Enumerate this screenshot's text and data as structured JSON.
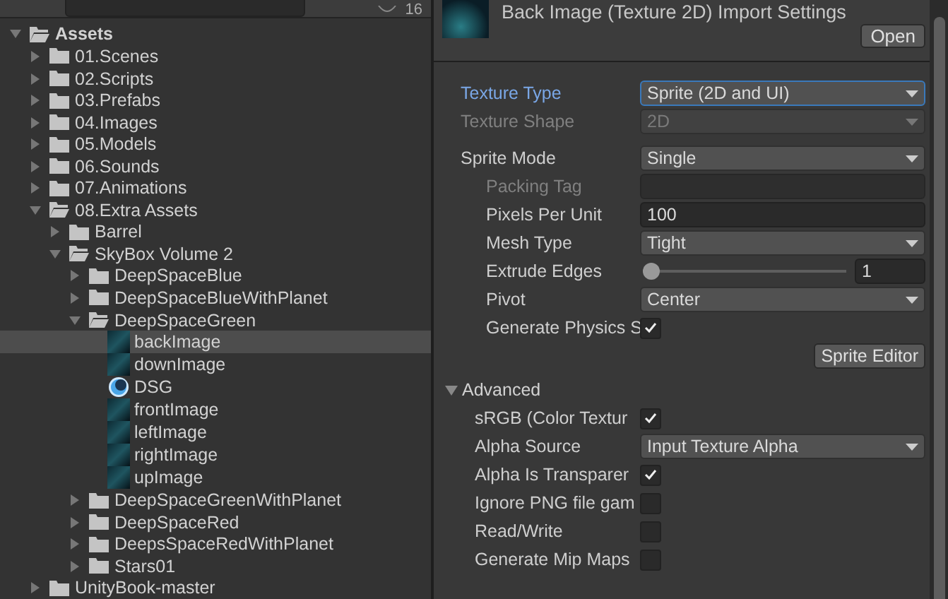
{
  "toolbar": {
    "count": "16"
  },
  "tree": [
    {
      "label": "Assets",
      "kind": "folder",
      "expanded": true,
      "selected": false,
      "children": [
        {
          "label": "01.Scenes",
          "kind": "folder",
          "expanded": false,
          "selected": false
        },
        {
          "label": "02.Scripts",
          "kind": "folder",
          "expanded": false,
          "selected": false
        },
        {
          "label": "03.Prefabs",
          "kind": "folder",
          "expanded": false,
          "selected": false
        },
        {
          "label": "04.Images",
          "kind": "folder",
          "expanded": false,
          "selected": false
        },
        {
          "label": "05.Models",
          "kind": "folder",
          "expanded": false,
          "selected": false
        },
        {
          "label": "06.Sounds",
          "kind": "folder",
          "expanded": false,
          "selected": false
        },
        {
          "label": "07.Animations",
          "kind": "folder",
          "expanded": false,
          "selected": false
        },
        {
          "label": "08.Extra Assets",
          "kind": "folder",
          "expanded": true,
          "selected": false,
          "children": [
            {
              "label": "Barrel",
              "kind": "folder",
              "expanded": false,
              "selected": false
            },
            {
              "label": "SkyBox Volume 2",
              "kind": "folder",
              "expanded": true,
              "selected": false,
              "children": [
                {
                  "label": "DeepSpaceBlue",
                  "kind": "folder",
                  "expanded": false,
                  "selected": false
                },
                {
                  "label": "DeepSpaceBlueWithPlanet",
                  "kind": "folder",
                  "expanded": false,
                  "selected": false
                },
                {
                  "label": "DeepSpaceGreen",
                  "kind": "folder",
                  "expanded": true,
                  "selected": false,
                  "children": [
                    {
                      "label": "backImage",
                      "kind": "texture",
                      "selected": true
                    },
                    {
                      "label": "downImage",
                      "kind": "texture",
                      "selected": false
                    },
                    {
                      "label": "DSG",
                      "kind": "material",
                      "selected": false
                    },
                    {
                      "label": "frontImage",
                      "kind": "texture",
                      "selected": false
                    },
                    {
                      "label": "leftImage",
                      "kind": "texture",
                      "selected": false
                    },
                    {
                      "label": "rightImage",
                      "kind": "texture",
                      "selected": false
                    },
                    {
                      "label": "upImage",
                      "kind": "texture",
                      "selected": false
                    }
                  ]
                },
                {
                  "label": "DeepSpaceGreenWithPlanet",
                  "kind": "folder",
                  "expanded": false,
                  "selected": false
                },
                {
                  "label": "DeepSpaceRed",
                  "kind": "folder",
                  "expanded": false,
                  "selected": false
                },
                {
                  "label": "DeepsSpaceRedWithPlanet",
                  "kind": "folder",
                  "expanded": false,
                  "selected": false
                },
                {
                  "label": "Stars01",
                  "kind": "folder",
                  "expanded": false,
                  "selected": false
                }
              ]
            }
          ]
        },
        {
          "label": "UnityBook-master",
          "kind": "folder",
          "expanded": false,
          "selected": false
        }
      ]
    }
  ],
  "inspector": {
    "title": "Back Image (Texture 2D) Import Settings",
    "open_button": "Open",
    "properties": [
      {
        "kind": "dropdown",
        "label": "Texture Type",
        "value": "Sprite (2D and UI)",
        "focused": true,
        "disabled": false
      },
      {
        "kind": "dropdown",
        "label": "Texture Shape",
        "value": "2D",
        "focused": false,
        "disabled": true
      },
      {
        "kind": "gap"
      },
      {
        "kind": "dropdown",
        "label": "Sprite Mode",
        "value": "Single",
        "focused": false,
        "disabled": false,
        "children": [
          {
            "kind": "input",
            "label": "Packing Tag",
            "disabled": true
          },
          {
            "kind": "input",
            "label": "Pixels Per Unit",
            "value": "100",
            "disabled": false
          },
          {
            "kind": "dropdown",
            "label": "Mesh Type",
            "value": "Tight",
            "focused": false,
            "disabled": false
          },
          {
            "kind": "slider",
            "label": "Extrude Edges",
            "value": "1",
            "level": 0.0
          },
          {
            "kind": "dropdown",
            "label": "Pivot",
            "value": "Center",
            "focused": false,
            "disabled": false
          },
          {
            "kind": "checkbox",
            "label": "Generate Physics S",
            "checked": true
          }
        ]
      },
      {
        "kind": "button",
        "label": "Sprite Editor"
      },
      {
        "kind": "section",
        "label": "Advanced",
        "expanded": true,
        "children": [
          {
            "kind": "checkbox",
            "label": "sRGB (Color Textur",
            "checked": true
          },
          {
            "kind": "dropdown",
            "label": "Alpha Source",
            "value": "Input Texture Alpha",
            "focused": false,
            "disabled": false
          },
          {
            "kind": "checkbox",
            "label": "Alpha Is Transparer",
            "checked": true
          },
          {
            "kind": "checkbox",
            "label": "Ignore PNG file gam",
            "checked": false
          },
          {
            "kind": "checkbox",
            "label": "Read/Write",
            "checked": false
          },
          {
            "kind": "checkbox",
            "label": "Generate Mip Maps",
            "checked": false
          }
        ]
      }
    ]
  }
}
